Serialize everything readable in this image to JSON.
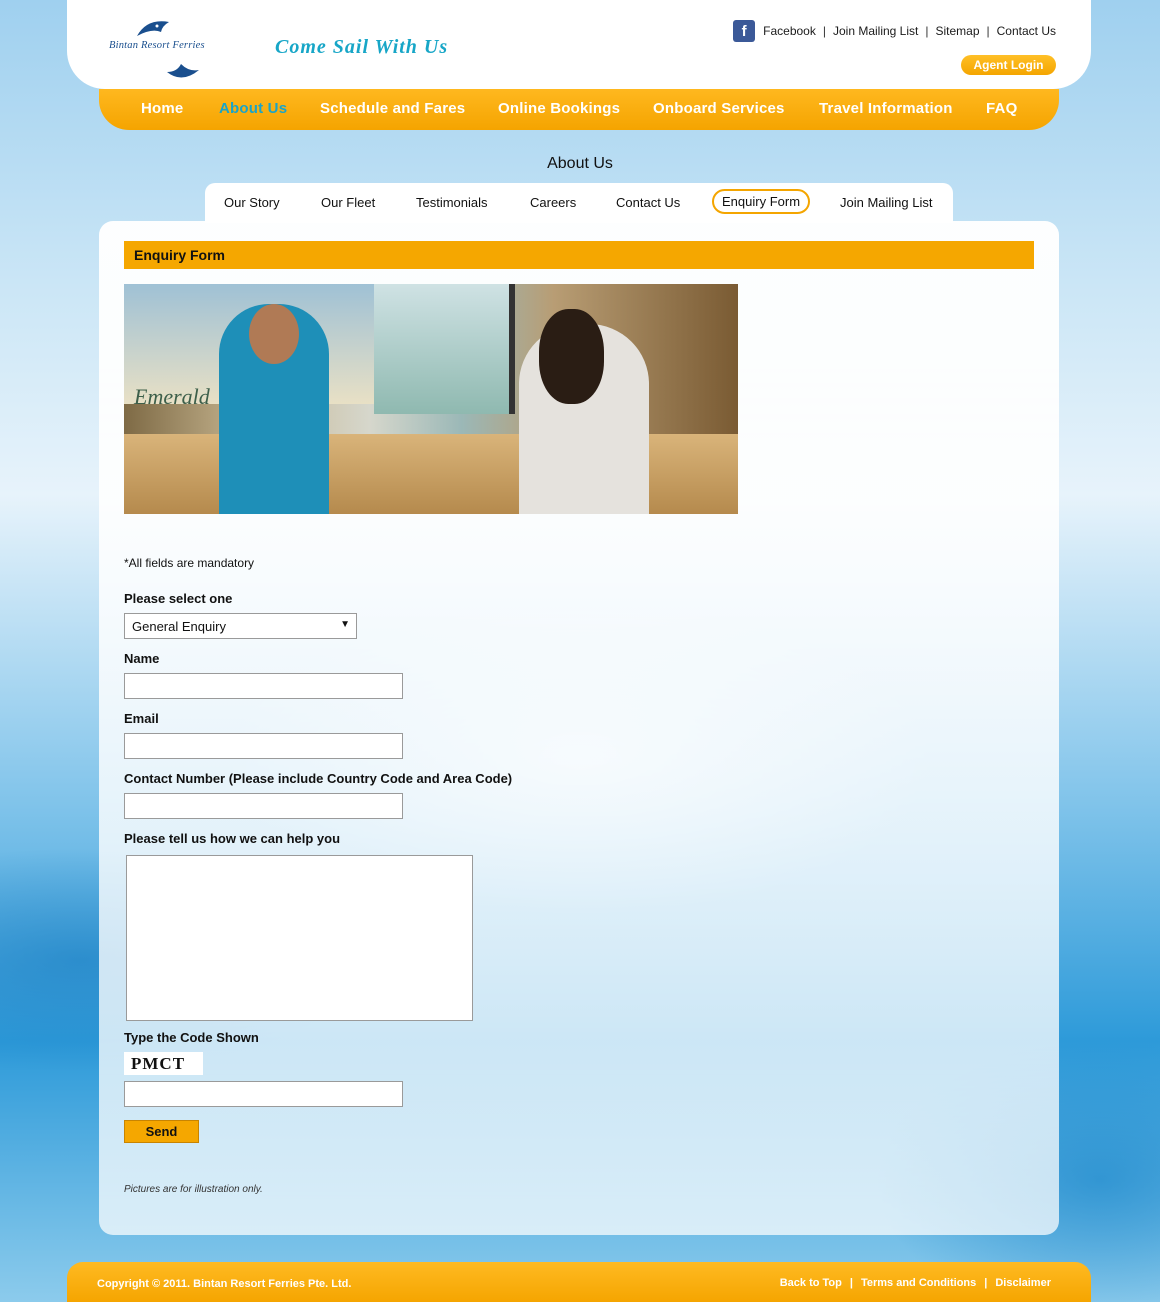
{
  "header": {
    "logo_text": "Bintan Resort Ferries",
    "tagline": "Come Sail With Us",
    "top_links": [
      "Facebook",
      "Join Mailing List",
      "Sitemap",
      "Contact Us"
    ],
    "agent_login": "Agent Login"
  },
  "nav": {
    "items": [
      "Home",
      "About Us",
      "Schedule and Fares",
      "Online Bookings",
      "Onboard Services",
      "Travel Information",
      "FAQ"
    ],
    "active": "About Us"
  },
  "section_title": "About Us",
  "subtabs": {
    "items": [
      "Our Story",
      "Our Fleet",
      "Testimonials",
      "Careers",
      "Contact Us",
      "Enquiry Form",
      "Join Mailing List"
    ],
    "active": "Enquiry Form"
  },
  "form": {
    "header": "Enquiry Form",
    "photo_sign": "Emerald",
    "mandatory_note": "*All fields are mandatory",
    "select_label": "Please select one",
    "select_value": "General Enquiry",
    "name_label": "Name",
    "email_label": "Email",
    "contact_label": "Contact Number (Please include Country Code and Area Code)",
    "message_label": "Please tell us how we can help you",
    "code_label": "Type the Code Shown",
    "captcha": "PMCT",
    "send": "Send",
    "disclaimer": "Pictures are for illustration only."
  },
  "footer": {
    "copyright": "Copyright © 2011. Bintan Resort Ferries Pte. Ltd.",
    "links": [
      "Back to Top",
      "Terms and Conditions",
      "Disclaimer"
    ]
  },
  "colors": {
    "accent": "#f5a700",
    "active_link": "#1aa4c8",
    "brand_blue": "#1a4f8e"
  }
}
